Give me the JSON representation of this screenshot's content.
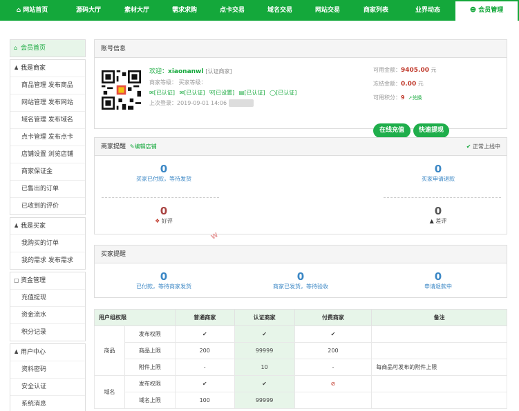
{
  "nav": {
    "items": [
      {
        "label": "网站首页",
        "icon": "home-icon"
      },
      {
        "label": "源码大厅"
      },
      {
        "label": "素材大厅"
      },
      {
        "label": "需求求购"
      },
      {
        "label": "点卡交易"
      },
      {
        "label": "域名交易"
      },
      {
        "label": "网站交易"
      },
      {
        "label": "商家列表"
      },
      {
        "label": "业界动态"
      },
      {
        "label": "会员管理",
        "icon": "users-icon",
        "active": true
      }
    ]
  },
  "sidebar": {
    "home": "会员首页",
    "groups": [
      {
        "title": "我是商家",
        "items": [
          "商品管理 发布商品",
          "网站管理 发布网站",
          "域名管理 发布域名",
          "点卡管理 发布点卡",
          "店铺设置 浏览店铺",
          "商家保证金",
          "已售出的订单",
          "已收到的评价"
        ]
      },
      {
        "title": "我是买家",
        "items": [
          "我购买的订单",
          "我的需求 发布需求"
        ]
      },
      {
        "title": "资金管理",
        "items": [
          "充值提现",
          "资金流水",
          "积分记录"
        ]
      },
      {
        "title": "用户中心",
        "items": [
          "资料密码",
          "安全认证",
          "系统消息"
        ]
      }
    ]
  },
  "account": {
    "title": "账号信息",
    "welcome_prefix": "欢迎：",
    "username": "xiaonanwl",
    "user_tag": "[认证商家]",
    "level_line": "商家等级：  买家等级：",
    "badges": [
      "[已认证]",
      "[已认证]",
      "[已设置]",
      "[已认证]",
      "[已认证]"
    ],
    "last_login": "上次登录：2019-09-01 14:06",
    "available_label": "可用金额：",
    "available_value": "9405.00",
    "available_unit": "元",
    "frozen_label": "冻结金额：",
    "frozen_value": "0.00",
    "frozen_unit": "元",
    "points_label": "可用积分：",
    "points_value": "9",
    "points_link": "兑换",
    "recharge_button": "在线充值",
    "withdraw_button": "快速提现"
  },
  "seller_alert": {
    "title": "商家提醒",
    "edit": "编辑店铺",
    "status": "正常上线中",
    "stats": [
      {
        "value": "0",
        "label": "买家已付款，等待发货"
      },
      {
        "value": "0",
        "label": "买家申请退款"
      },
      {
        "value": "0",
        "label": "好评"
      },
      {
        "value": "0",
        "label": "差评"
      }
    ]
  },
  "buyer_alert": {
    "title": "买家提醒",
    "stats": [
      {
        "value": "0",
        "label": "已付款，等待商家发货"
      },
      {
        "value": "0",
        "label": "商家已发货，等待验收"
      },
      {
        "value": "0",
        "label": "申请退款中"
      }
    ]
  },
  "permissions": {
    "headers": [
      "用户组权限",
      "普通商家",
      "认证商家",
      "付费商家",
      "备注"
    ],
    "groups": [
      {
        "name": "商品",
        "rows": [
          {
            "label": "发布权限",
            "normal": "✔",
            "certified": "✔",
            "paid": "✔",
            "note": ""
          },
          {
            "label": "商品上限",
            "normal": "200",
            "certified": "99999",
            "paid": "200",
            "note": ""
          },
          {
            "label": "附件上限",
            "normal": "-",
            "certified": "10",
            "paid": "-",
            "note": "每商品可发布的附件上限"
          }
        ]
      },
      {
        "name": "域名",
        "rows": [
          {
            "label": "发布权限",
            "normal": "✔",
            "certified": "✔",
            "paid": "⊘",
            "note": ""
          },
          {
            "label": "域名上限",
            "normal": "100",
            "certified": "99999",
            "paid": "",
            "note": ""
          }
        ]
      }
    ]
  },
  "watermark": "W"
}
